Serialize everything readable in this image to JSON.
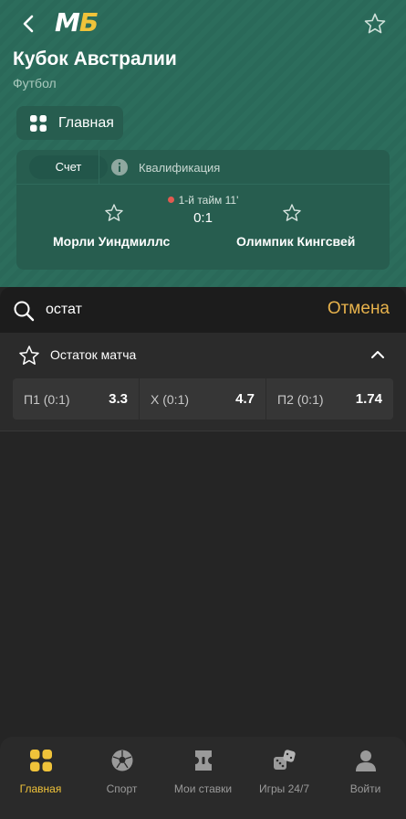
{
  "header": {
    "logo_m": "М",
    "logo_b": "Б",
    "title": "Кубок Австралии",
    "subtitle": "Футбол",
    "main_button": "Главная"
  },
  "match": {
    "tabs": [
      "Счет",
      "Квалификация"
    ],
    "status": "1-й тайм 11'",
    "score": "0:1",
    "home_team": "Морли Уиндмиллс",
    "away_team": "Олимпик Кингсвей"
  },
  "search": {
    "value": "остат",
    "cancel_label": "Отмена"
  },
  "market": {
    "name": "Остаток матча",
    "odds": [
      {
        "label": "П1 (0:1)",
        "value": "3.3"
      },
      {
        "label": "Х (0:1)",
        "value": "4.7"
      },
      {
        "label": "П2 (0:1)",
        "value": "1.74"
      }
    ]
  },
  "bottom_nav": [
    {
      "label": "Главная",
      "icon": "home-grid-icon",
      "active": true
    },
    {
      "label": "Спорт",
      "icon": "soccer-ball-icon",
      "active": false
    },
    {
      "label": "Мои ставки",
      "icon": "ticket-icon",
      "active": false
    },
    {
      "label": "Игры 24/7",
      "icon": "dice-icon",
      "active": false
    },
    {
      "label": "Войти",
      "icon": "user-icon",
      "active": false
    }
  ],
  "colors": {
    "header_green": "#2c6d5c",
    "accent_yellow": "#f0c33a",
    "cancel_orange": "#e7b24c",
    "live_red": "#e35a50"
  }
}
